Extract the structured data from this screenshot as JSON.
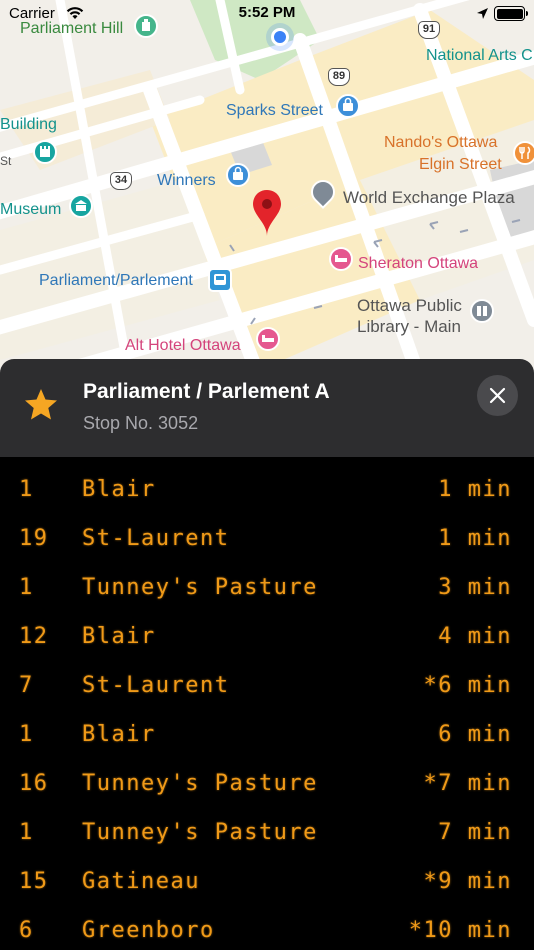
{
  "status_bar": {
    "carrier": "Carrier",
    "time": "5:52 PM"
  },
  "map": {
    "labels": {
      "parliament_hill": "Parliament Hill",
      "national_arts": "National Arts C",
      "sparks_street": "Sparks Street",
      "building": "Building",
      "nandos_line1": "Nando's Ottawa",
      "nandos_line2": "Elgin Street",
      "winners": "Winners",
      "world_exchange": "World Exchange Plaza",
      "museum": "Museum",
      "parliament_station": "Parliament/Parlement",
      "sheraton": "Sheraton Ottawa",
      "library_line1": "Ottawa Public",
      "library_line2": "Library - Main",
      "alt_hotel": "Alt Hotel Ottawa",
      "street_st": "St"
    },
    "shields": [
      "91",
      "89",
      "34"
    ],
    "colors": {
      "background": "#f2efe9",
      "roads": "#ffffff",
      "blocks": "#faecc4",
      "park": "#cfe8c4",
      "selected_pin": "#e3242b",
      "user_location": "#3b82f6"
    }
  },
  "stop": {
    "favorite_icon": "star-icon",
    "favorite_color": "#f5a623",
    "title": "Parliament / Parlement A",
    "number_text": "Stop No. 3052"
  },
  "departures": [
    {
      "route": "1",
      "destination": "Blair",
      "time": "1 min"
    },
    {
      "route": "19",
      "destination": "St-Laurent",
      "time": "1 min"
    },
    {
      "route": "1",
      "destination": "Tunney's Pasture",
      "time": "3 min"
    },
    {
      "route": "12",
      "destination": "Blair",
      "time": "4 min"
    },
    {
      "route": "7",
      "destination": "St-Laurent",
      "time": "*6 min"
    },
    {
      "route": "1",
      "destination": "Blair",
      "time": "6 min"
    },
    {
      "route": "16",
      "destination": "Tunney's Pasture",
      "time": "*7 min"
    },
    {
      "route": "1",
      "destination": "Tunney's Pasture",
      "time": "7 min"
    },
    {
      "route": "15",
      "destination": "Gatineau",
      "time": "*9 min"
    },
    {
      "route": "6",
      "destination": "Greenboro",
      "time": "*10 min"
    }
  ],
  "theme": {
    "led_color": "#f09a18",
    "sheet_header_bg": "#2d2d2f"
  }
}
